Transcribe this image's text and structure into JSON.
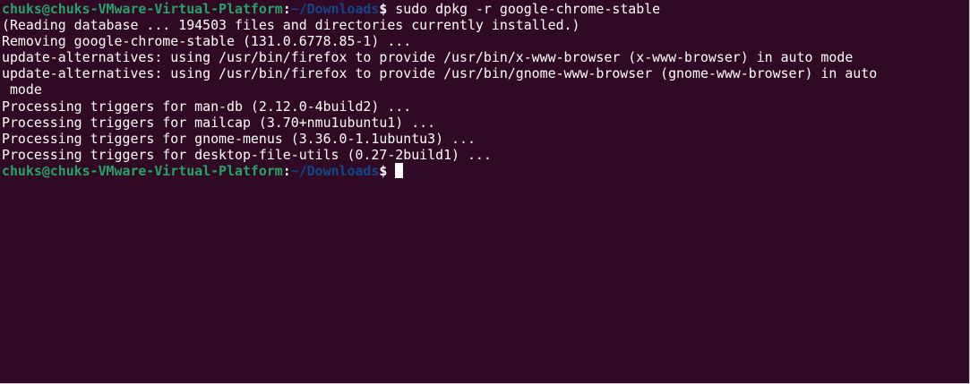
{
  "prompt": {
    "user_host": "chuks@chuks-VMware-Virtual-Platform",
    "separator": ":",
    "path": "~/Downloads",
    "symbol": "$"
  },
  "command": " sudo dpkg -r google-chrome-stable",
  "output": [
    "(Reading database ... 194503 files and directories currently installed.)",
    "Removing google-chrome-stable (131.0.6778.85-1) ...",
    "update-alternatives: using /usr/bin/firefox to provide /usr/bin/x-www-browser (x-www-browser) in auto mode",
    "update-alternatives: using /usr/bin/firefox to provide /usr/bin/gnome-www-browser (gnome-www-browser) in auto",
    " mode",
    "Processing triggers for man-db (2.12.0-4build2) ...",
    "Processing triggers for mailcap (3.70+nmu1ubuntu1) ...",
    "Processing triggers for gnome-menus (3.36.0-1.1ubuntu3) ...",
    "Processing triggers for desktop-file-utils (0.27-2build1) ..."
  ],
  "colors": {
    "background": "#300a24",
    "user_host": "#26a269",
    "path": "#12488b",
    "text": "#ffffff"
  }
}
